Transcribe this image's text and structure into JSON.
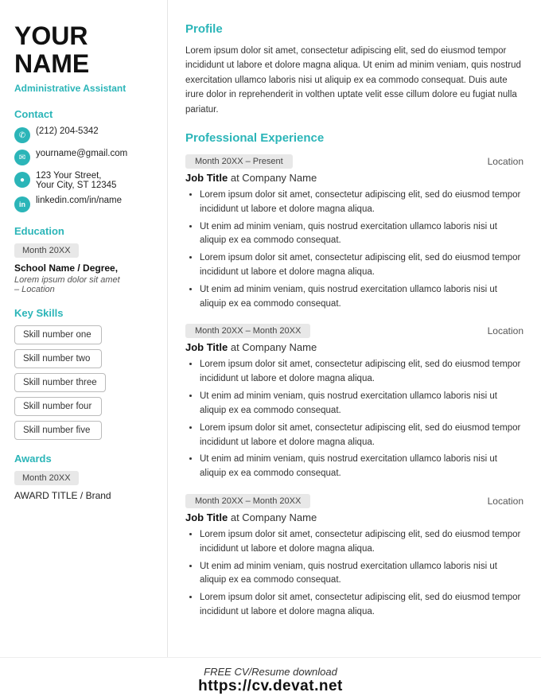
{
  "sidebar": {
    "name_line1": "YOUR",
    "name_line2": "NAME",
    "job_title": "Administrative Assistant",
    "contact_label": "Contact",
    "contact_items": [
      {
        "icon": "phone",
        "text": "(212) 204-5342"
      },
      {
        "icon": "email",
        "text": "yourname@gmail.com"
      },
      {
        "icon": "location",
        "text": "123 Your Street,\nYour City, ST 12345"
      },
      {
        "icon": "linkedin",
        "text": "linkedin.com/in/name"
      }
    ],
    "education_label": "Education",
    "education": {
      "date": "Month 20XX",
      "school": "School Name / Degree,",
      "desc": "Lorem ipsum dolor sit amet\n– Location"
    },
    "skills_label": "Key Skills",
    "skills": [
      "Skill number one",
      "Skill number two",
      "Skill number three",
      "Skill number four",
      "Skill number five"
    ],
    "awards_label": "Awards",
    "awards": {
      "date": "Month 20XX",
      "title": "AWARD TITLE / Brand"
    }
  },
  "main": {
    "profile_heading": "Profile",
    "profile_text": "Lorem ipsum dolor sit amet, consectetur adipiscing elit, sed do eiusmod tempor incididunt ut labore et dolore magna aliqua. Ut enim ad minim veniam, quis nostrud exercitation ullamco laboris nisi ut aliquip ex ea commodo consequat. Duis aute irure dolor in reprehenderit in volthen uptate velit esse cillum dolore eu fugiat nulla pariatur.",
    "experience_heading": "Professional Experience",
    "experiences": [
      {
        "date": "Month 20XX – Present",
        "location": "Location",
        "job_title": "Job Title",
        "company": "Company Name",
        "bullets": [
          "Lorem ipsum dolor sit amet, consectetur adipiscing elit, sed do eiusmod tempor incididunt ut labore et dolore magna aliqua.",
          "Ut enim ad minim veniam, quis nostrud exercitation ullamco laboris nisi ut aliquip ex ea commodo consequat.",
          "Lorem ipsum dolor sit amet, consectetur adipiscing elit, sed do eiusmod tempor incididunt ut labore et dolore magna aliqua.",
          "Ut enim ad minim veniam, quis nostrud exercitation ullamco laboris nisi ut aliquip ex ea commodo consequat."
        ]
      },
      {
        "date": "Month 20XX – Month 20XX",
        "location": "Location",
        "job_title": "Job Title",
        "company": "Company Name",
        "bullets": [
          "Lorem ipsum dolor sit amet, consectetur adipiscing elit, sed do eiusmod tempor incididunt ut labore et dolore magna aliqua.",
          "Ut enim ad minim veniam, quis nostrud exercitation ullamco laboris nisi ut aliquip ex ea commodo consequat.",
          "Lorem ipsum dolor sit amet, consectetur adipiscing elit, sed do eiusmod tempor incididunt ut labore et dolore magna aliqua.",
          "Ut enim ad minim veniam, quis nostrud exercitation ullamco laboris nisi ut aliquip ex ea commodo consequat."
        ]
      },
      {
        "date": "Month 20XX – Month 20XX",
        "location": "Location",
        "job_title": "Job Title",
        "company": "Company Name",
        "bullets": [
          "Lorem ipsum dolor sit amet, consectetur adipiscing elit, sed do eiusmod tempor incididunt ut labore et dolore magna aliqua.",
          "Ut enim ad minim veniam, quis nostrud exercitation ullamco laboris nisi ut aliquip ex ea commodo consequat.",
          "Lorem ipsum dolor sit amet, consectetur adipiscing elit, sed do eiusmod tempor incididunt ut labore et dolore magna aliqua."
        ]
      }
    ]
  },
  "footer": {
    "line1": "FREE CV/Resume download",
    "line2": "https://cv.devat.net"
  },
  "colors": {
    "accent": "#2bb5b8"
  }
}
